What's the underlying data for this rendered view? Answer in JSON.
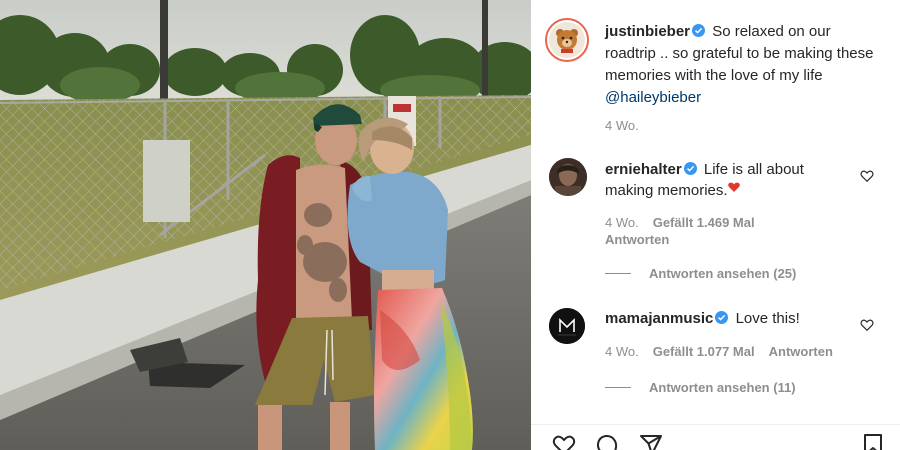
{
  "post": {
    "author": "justinbieber",
    "caption": "So relaxed on our roadtrip .. so grateful to be making these memories with the love of my life",
    "mention": "@haileybieber",
    "timestamp": "4 Wo."
  },
  "comments": [
    {
      "user": "erniehalter",
      "text": "Life is all about making memories.",
      "timestamp": "4 Wo.",
      "likes": "Gefällt 1.469 Mal",
      "reply_label": "Antworten",
      "view_replies": "Antworten ansehen (25)"
    },
    {
      "user": "mamajanmusic",
      "text": "Love this!",
      "timestamp": "4 Wo.",
      "likes": "Gefällt 1.077 Mal",
      "reply_label": "Antworten",
      "view_replies": "Antworten ansehen (11)"
    }
  ],
  "colors": {
    "verified": "#3897f0",
    "mention": "#00376b",
    "muted": "#8e8e8e",
    "text": "#262626"
  },
  "icons": [
    "verified-badge-icon",
    "like-heart-icon",
    "comment-icon",
    "share-icon",
    "save-bookmark-icon",
    "red-heart-emoji-icon"
  ]
}
